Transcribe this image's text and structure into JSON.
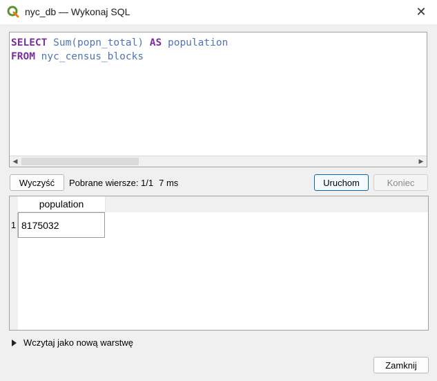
{
  "window": {
    "title": "nyc_db — Wykonaj SQL",
    "icon": "qgis-logo-icon",
    "close_symbol": "✕"
  },
  "editor": {
    "lines": [
      {
        "kw": "SELECT",
        "rest": " Sum(popn_total) ",
        "kw2": "AS",
        "rest2": " population"
      },
      {
        "kw": "FROM",
        "rest": " nyc_census_blocks"
      }
    ]
  },
  "toolbar": {
    "clear_label": "Wyczyść",
    "status_label": "Pobrane wiersze: 1/1",
    "time_label": "7 ms",
    "run_label": "Uruchom",
    "stop_label": "Koniec"
  },
  "results": {
    "columns": [
      "population"
    ],
    "rows": [
      {
        "num": "1",
        "cells": [
          "8175032"
        ]
      }
    ]
  },
  "load_layer_label": "Wczytaj jako nową warstwę",
  "footer": {
    "close_label": "Zamknij"
  },
  "colors": {
    "keyword": "#7a2e9e",
    "identifier": "#4e74b5",
    "accent": "#0067c0"
  }
}
